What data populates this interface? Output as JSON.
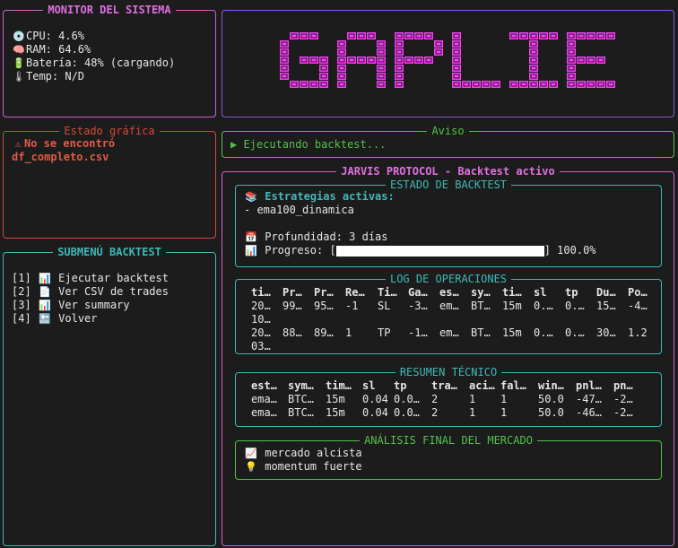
{
  "monitor": {
    "title": "MONITOR DEL SISTEMA",
    "cpu": "CPU: 4.6%",
    "ram": "RAM: 64.6%",
    "battery": "Batería: 48% (cargando)",
    "temp": "Temp: N/D"
  },
  "logo": {
    "text": "GAPLIE"
  },
  "graph_state": {
    "title": "Estado gráfica",
    "message_line1": "No se encontró",
    "message_line2": "df_completo.csv"
  },
  "notice": {
    "title": "Aviso",
    "message": "▶ Ejecutando backtest..."
  },
  "submenu": {
    "title": "SUBMENÚ BACKTEST",
    "items": [
      {
        "key": "[1]",
        "label": "Ejecutar backtest"
      },
      {
        "key": "[2]",
        "label": "Ver CSV de trades"
      },
      {
        "key": "[3]",
        "label": "Ver summary"
      },
      {
        "key": "[4]",
        "label": "Volver"
      }
    ]
  },
  "jarvis": {
    "title": "JARVIS PROTOCOL - Backtest activo"
  },
  "backtest_state": {
    "title": "ESTADO DE BACKTEST",
    "strategies_label": "Estrategias activas:",
    "strategy": "- ema100_dinamica",
    "depth": "Profundidad: 3 días",
    "progress_label": "Progreso: [",
    "progress_end": "] 100.0%",
    "progress": 1.0
  },
  "ops_log": {
    "title": "LOG DE OPERACIONES",
    "headers": [
      "ti…",
      "Pr…",
      "Pr…",
      "Re…",
      "Ti…",
      "Ga…",
      "es…",
      "sy…",
      "ti…",
      "sl",
      "tp",
      "Du…",
      "Po…"
    ],
    "rows": [
      {
        "c": [
          "20…",
          "99…",
          "95…",
          "-1",
          "SL",
          "-3…",
          "em…",
          "BT…",
          "15m",
          "0.…",
          "0.…",
          "15…",
          "-4…"
        ],
        "w": "10…"
      },
      {
        "c": [
          "20…",
          "88…",
          "89…",
          "1",
          "TP",
          "-1…",
          "em…",
          "BT…",
          "15m",
          "0.…",
          "0.…",
          "30…",
          "1.2"
        ],
        "w": "03…"
      }
    ]
  },
  "tech_summary": {
    "title": "RESUMEN TÉCNICO",
    "headers": [
      "est…",
      "sym…",
      "tim…",
      "sl",
      "tp",
      "tra…",
      "aci…",
      "fal…",
      "win…",
      "pnl…",
      "pn…"
    ],
    "rows": [
      [
        "ema…",
        "BTC…",
        "15m",
        "0.04",
        "0.0…",
        "2",
        "1",
        "1",
        "50.0",
        "-47…",
        "-2…"
      ],
      [
        "ema…",
        "BTC…",
        "15m",
        "0.04",
        "0.0…",
        "2",
        "1",
        "1",
        "50.0",
        "-46…",
        "-2…"
      ]
    ]
  },
  "market": {
    "title": "ANÁLISIS FINAL DEL MERCADO",
    "line1": "mercado alcista",
    "line2": "momentum fuerte"
  },
  "colors": {
    "magenta": "#d65ed6",
    "red": "#d24a3a",
    "cyan": "#3fb8b8",
    "green": "#52c24a",
    "logo": "#ff3cff"
  }
}
